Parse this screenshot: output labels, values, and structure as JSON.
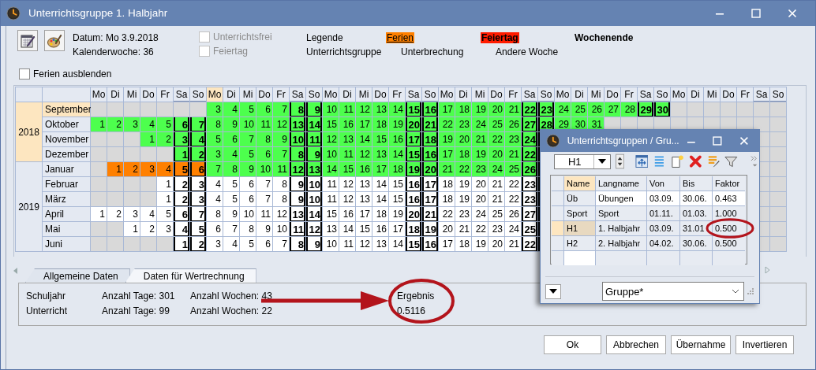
{
  "window": {
    "title": "Unterrichtsgruppe 1. Halbjahr"
  },
  "toolbar": {
    "info": [
      "Datum: Mo 3.9.2018",
      "Kalenderwoche: 36"
    ],
    "options": [
      {
        "label": "Unterrichtsfrei",
        "checked": false,
        "disabled": true
      },
      {
        "label": "Feiertag",
        "checked": false,
        "disabled": true
      }
    ],
    "legend_rows": [
      [
        {
          "label": "Legende",
          "kind": "title"
        },
        {
          "label": "Ferien",
          "kind": "holiday"
        },
        {
          "label": "Feiertag",
          "kind": "public_holiday"
        },
        {
          "label": "Wochenende",
          "kind": "weekend"
        }
      ],
      [
        {
          "label": "Unterrichtsgruppe",
          "kind": "plain"
        },
        {
          "label": "Unterbrechung",
          "kind": "plain"
        },
        {
          "label": "Andere Woche",
          "kind": "plain"
        }
      ]
    ],
    "hide_holidays": {
      "label": "Ferien ausblenden",
      "checked": false
    }
  },
  "calendar": {
    "weekdays": [
      {
        "label": "Mo",
        "weekend": false,
        "current": false
      },
      {
        "label": "Di",
        "weekend": false,
        "current": false
      },
      {
        "label": "Mi",
        "weekend": false,
        "current": false
      },
      {
        "label": "Do",
        "weekend": false,
        "current": false
      },
      {
        "label": "Fr",
        "weekend": false,
        "current": false
      },
      {
        "label": "Sa",
        "weekend": true,
        "current": false
      },
      {
        "label": "So",
        "weekend": true,
        "current": false
      },
      {
        "label": "Mo",
        "weekend": false,
        "current": true
      },
      {
        "label": "Di",
        "weekend": false,
        "current": false
      },
      {
        "label": "Mi",
        "weekend": false,
        "current": false
      },
      {
        "label": "Do",
        "weekend": false,
        "current": false
      },
      {
        "label": "Fr",
        "weekend": false,
        "current": false
      },
      {
        "label": "Sa",
        "weekend": true,
        "current": false
      },
      {
        "label": "So",
        "weekend": true,
        "current": false
      },
      {
        "label": "Mo",
        "weekend": false,
        "current": false
      },
      {
        "label": "Di",
        "weekend": false,
        "current": false
      },
      {
        "label": "Mi",
        "weekend": false,
        "current": false
      },
      {
        "label": "Do",
        "weekend": false,
        "current": false
      },
      {
        "label": "Fr",
        "weekend": false,
        "current": false
      },
      {
        "label": "Sa",
        "weekend": true,
        "current": false
      },
      {
        "label": "So",
        "weekend": true,
        "current": false
      },
      {
        "label": "Mo",
        "weekend": false,
        "current": false
      },
      {
        "label": "Di",
        "weekend": false,
        "current": false
      },
      {
        "label": "Mi",
        "weekend": false,
        "current": false
      },
      {
        "label": "Do",
        "weekend": false,
        "current": false
      },
      {
        "label": "Fr",
        "weekend": false,
        "current": false
      },
      {
        "label": "Sa",
        "weekend": true,
        "current": false
      },
      {
        "label": "So",
        "weekend": true,
        "current": false
      },
      {
        "label": "Mo",
        "weekend": false,
        "current": false
      },
      {
        "label": "Di",
        "weekend": false,
        "current": false
      },
      {
        "label": "Mi",
        "weekend": false,
        "current": false
      },
      {
        "label": "Do",
        "weekend": false,
        "current": false
      },
      {
        "label": "Fr",
        "weekend": false,
        "current": false
      },
      {
        "label": "Sa",
        "weekend": true,
        "current": false
      },
      {
        "label": "So",
        "weekend": true,
        "current": false
      },
      {
        "label": "Mo",
        "weekend": false,
        "current": false
      },
      {
        "label": "Di",
        "weekend": false,
        "current": false
      },
      {
        "label": "Mi",
        "weekend": false,
        "current": false
      },
      {
        "label": "Do",
        "weekend": false,
        "current": false
      },
      {
        "label": "Fr",
        "weekend": false,
        "current": false
      },
      {
        "label": "Sa",
        "weekend": true,
        "current": false
      },
      {
        "label": "So",
        "weekend": true,
        "current": false
      }
    ],
    "years": [
      {
        "label": "2018",
        "selected": true,
        "months": [
          {
            "name": "September",
            "selected": true,
            "cells": [
              {
                "kind": "blank"
              },
              {
                "kind": "blank"
              },
              {
                "kind": "blank"
              },
              {
                "kind": "blank"
              },
              {
                "kind": "blank"
              },
              {
                "kind": "blank"
              },
              {
                "kind": "blank"
              },
              {
                "day": "3",
                "kind": "class"
              },
              {
                "day": "4",
                "kind": "class"
              },
              {
                "day": "5",
                "kind": "class"
              },
              {
                "day": "6",
                "kind": "class"
              },
              {
                "day": "7",
                "kind": "class"
              },
              {
                "day": "8",
                "kind": "class"
              },
              {
                "day": "9",
                "kind": "class"
              },
              {
                "day": "10",
                "kind": "class"
              },
              {
                "day": "11",
                "kind": "class"
              },
              {
                "day": "12",
                "kind": "class"
              },
              {
                "day": "13",
                "kind": "class"
              },
              {
                "day": "14",
                "kind": "class"
              },
              {
                "day": "15",
                "kind": "class"
              },
              {
                "day": "16",
                "kind": "class"
              },
              {
                "day": "17",
                "kind": "class"
              },
              {
                "day": "18",
                "kind": "class"
              },
              {
                "day": "19",
                "kind": "class"
              },
              {
                "day": "20",
                "kind": "class"
              },
              {
                "day": "21",
                "kind": "class"
              },
              {
                "day": "22",
                "kind": "class"
              },
              {
                "day": "23",
                "kind": "class"
              },
              {
                "day": "24",
                "kind": "class"
              },
              {
                "day": "25",
                "kind": "class"
              },
              {
                "day": "26",
                "kind": "class"
              },
              {
                "day": "27",
                "kind": "class"
              },
              {
                "day": "28",
                "kind": "class"
              },
              {
                "day": "29",
                "kind": "class"
              },
              {
                "day": "30",
                "kind": "class"
              }
            ]
          },
          {
            "name": "Oktober",
            "selected": false,
            "cells": [
              {
                "day": "1",
                "kind": "class"
              },
              {
                "day": "2",
                "kind": "class"
              },
              {
                "day": "3",
                "kind": "class"
              },
              {
                "day": "4",
                "kind": "class"
              },
              {
                "day": "5",
                "kind": "class"
              },
              {
                "day": "6",
                "kind": "class"
              },
              {
                "day": "7",
                "kind": "class"
              },
              {
                "day": "8",
                "kind": "class"
              },
              {
                "day": "9",
                "kind": "class"
              },
              {
                "day": "10",
                "kind": "class"
              },
              {
                "day": "11",
                "kind": "class"
              },
              {
                "day": "12",
                "kind": "class"
              },
              {
                "day": "13",
                "kind": "class"
              },
              {
                "day": "14",
                "kind": "class"
              },
              {
                "day": "15",
                "kind": "class"
              },
              {
                "day": "16",
                "kind": "class"
              },
              {
                "day": "17",
                "kind": "class"
              },
              {
                "day": "18",
                "kind": "class"
              },
              {
                "day": "19",
                "kind": "class"
              },
              {
                "day": "20",
                "kind": "class"
              },
              {
                "day": "21",
                "kind": "class"
              },
              {
                "day": "22",
                "kind": "class"
              },
              {
                "day": "23",
                "kind": "class"
              },
              {
                "day": "24",
                "kind": "class"
              },
              {
                "day": "25",
                "kind": "class"
              },
              {
                "day": "26",
                "kind": "class"
              },
              {
                "day": "27",
                "kind": "class"
              },
              {
                "day": "28",
                "kind": "class"
              },
              {
                "day": "29",
                "kind": "class"
              },
              {
                "day": "30",
                "kind": "class"
              },
              {
                "day": "31",
                "kind": "class"
              }
            ]
          },
          {
            "name": "November",
            "selected": false,
            "cells": [
              {
                "kind": "blank"
              },
              {
                "kind": "blank"
              },
              {
                "kind": "blank"
              },
              {
                "day": "1",
                "kind": "class"
              },
              {
                "day": "2",
                "kind": "class"
              },
              {
                "day": "3",
                "kind": "class"
              },
              {
                "day": "4",
                "kind": "class"
              },
              {
                "day": "5",
                "kind": "class"
              },
              {
                "day": "6",
                "kind": "class"
              },
              {
                "day": "7",
                "kind": "class"
              },
              {
                "day": "8",
                "kind": "class"
              },
              {
                "day": "9",
                "kind": "class"
              },
              {
                "day": "10",
                "kind": "class"
              },
              {
                "day": "11",
                "kind": "class"
              },
              {
                "day": "12",
                "kind": "class"
              },
              {
                "day": "13",
                "kind": "class"
              },
              {
                "day": "14",
                "kind": "class"
              },
              {
                "day": "15",
                "kind": "class"
              },
              {
                "day": "16",
                "kind": "class"
              },
              {
                "day": "17",
                "kind": "class"
              },
              {
                "day": "18",
                "kind": "class"
              },
              {
                "day": "19",
                "kind": "class"
              },
              {
                "day": "20",
                "kind": "class"
              },
              {
                "day": "21",
                "kind": "class"
              },
              {
                "day": "22",
                "kind": "class"
              },
              {
                "day": "23",
                "kind": "class"
              },
              {
                "day": "24",
                "kind": "class"
              },
              {
                "kind": "class"
              }
            ]
          },
          {
            "name": "Dezember",
            "selected": false,
            "cells": [
              {
                "kind": "blank"
              },
              {
                "kind": "blank"
              },
              {
                "kind": "blank"
              },
              {
                "kind": "blank"
              },
              {
                "kind": "blank"
              },
              {
                "day": "1",
                "kind": "class"
              },
              {
                "day": "2",
                "kind": "class"
              },
              {
                "day": "3",
                "kind": "class"
              },
              {
                "day": "4",
                "kind": "class"
              },
              {
                "day": "5",
                "kind": "class"
              },
              {
                "day": "6",
                "kind": "class"
              },
              {
                "day": "7",
                "kind": "class"
              },
              {
                "day": "8",
                "kind": "class"
              },
              {
                "day": "9",
                "kind": "class"
              },
              {
                "day": "10",
                "kind": "class"
              },
              {
                "day": "11",
                "kind": "class"
              },
              {
                "day": "12",
                "kind": "class"
              },
              {
                "day": "13",
                "kind": "class"
              },
              {
                "day": "14",
                "kind": "class"
              },
              {
                "day": "15",
                "kind": "class"
              },
              {
                "day": "16",
                "kind": "class"
              },
              {
                "day": "17",
                "kind": "class"
              },
              {
                "day": "18",
                "kind": "class"
              },
              {
                "day": "19",
                "kind": "class"
              },
              {
                "day": "20",
                "kind": "class"
              },
              {
                "day": "21",
                "kind": "class"
              },
              {
                "day": "22",
                "kind": "class"
              },
              {
                "kind": "class"
              }
            ]
          }
        ]
      },
      {
        "label": "2019",
        "selected": false,
        "months": [
          {
            "name": "Januar",
            "selected": false,
            "cells": [
              {
                "kind": "blank"
              },
              {
                "day": "1",
                "kind": "holiday"
              },
              {
                "day": "2",
                "kind": "holiday"
              },
              {
                "day": "3",
                "kind": "holiday"
              },
              {
                "day": "4",
                "kind": "holiday"
              },
              {
                "day": "5",
                "kind": "holiday"
              },
              {
                "day": "6",
                "kind": "holiday"
              },
              {
                "day": "7",
                "kind": "class"
              },
              {
                "day": "8",
                "kind": "class"
              },
              {
                "day": "9",
                "kind": "class"
              },
              {
                "day": "10",
                "kind": "class"
              },
              {
                "day": "11",
                "kind": "class"
              },
              {
                "day": "12",
                "kind": "class"
              },
              {
                "day": "13",
                "kind": "class"
              },
              {
                "day": "14",
                "kind": "class"
              },
              {
                "day": "15",
                "kind": "class"
              },
              {
                "day": "16",
                "kind": "class"
              },
              {
                "day": "17",
                "kind": "class"
              },
              {
                "day": "18",
                "kind": "class"
              },
              {
                "day": "19",
                "kind": "class"
              },
              {
                "day": "20",
                "kind": "class"
              },
              {
                "day": "21",
                "kind": "class"
              },
              {
                "day": "22",
                "kind": "class"
              },
              {
                "day": "23",
                "kind": "class"
              },
              {
                "day": "24",
                "kind": "class"
              },
              {
                "day": "25",
                "kind": "class"
              },
              {
                "day": "26",
                "kind": "class"
              },
              {
                "kind": "class"
              }
            ]
          },
          {
            "name": "Februar",
            "selected": false,
            "cells": [
              {
                "kind": "blank"
              },
              {
                "kind": "blank"
              },
              {
                "kind": "blank"
              },
              {
                "kind": "blank"
              },
              {
                "day": "1",
                "kind": "other"
              },
              {
                "day": "2",
                "kind": "other"
              },
              {
                "day": "3",
                "kind": "other"
              },
              {
                "day": "4",
                "kind": "other"
              },
              {
                "day": "5",
                "kind": "other"
              },
              {
                "day": "6",
                "kind": "other"
              },
              {
                "day": "7",
                "kind": "other"
              },
              {
                "day": "8",
                "kind": "other"
              },
              {
                "day": "9",
                "kind": "other"
              },
              {
                "day": "10",
                "kind": "other"
              },
              {
                "day": "11",
                "kind": "other"
              },
              {
                "day": "12",
                "kind": "other"
              },
              {
                "day": "13",
                "kind": "other"
              },
              {
                "day": "14",
                "kind": "other"
              },
              {
                "day": "15",
                "kind": "other"
              },
              {
                "day": "16",
                "kind": "other"
              },
              {
                "day": "17",
                "kind": "other"
              },
              {
                "day": "18",
                "kind": "other"
              },
              {
                "day": "19",
                "kind": "other"
              },
              {
                "day": "20",
                "kind": "other"
              },
              {
                "day": "21",
                "kind": "other"
              },
              {
                "day": "22",
                "kind": "other"
              },
              {
                "day": "23",
                "kind": "other"
              },
              {
                "kind": "other"
              }
            ]
          },
          {
            "name": "März",
            "selected": false,
            "cells": [
              {
                "kind": "blank"
              },
              {
                "kind": "blank"
              },
              {
                "kind": "blank"
              },
              {
                "kind": "blank"
              },
              {
                "day": "1",
                "kind": "other"
              },
              {
                "day": "2",
                "kind": "other"
              },
              {
                "day": "3",
                "kind": "other"
              },
              {
                "day": "4",
                "kind": "other"
              },
              {
                "day": "5",
                "kind": "other"
              },
              {
                "day": "6",
                "kind": "other"
              },
              {
                "day": "7",
                "kind": "other"
              },
              {
                "day": "8",
                "kind": "other"
              },
              {
                "day": "9",
                "kind": "other"
              },
              {
                "day": "10",
                "kind": "other"
              },
              {
                "day": "11",
                "kind": "other"
              },
              {
                "day": "12",
                "kind": "other"
              },
              {
                "day": "13",
                "kind": "other"
              },
              {
                "day": "14",
                "kind": "other"
              },
              {
                "day": "15",
                "kind": "other"
              },
              {
                "day": "16",
                "kind": "other"
              },
              {
                "day": "17",
                "kind": "other"
              },
              {
                "day": "18",
                "kind": "other"
              },
              {
                "day": "19",
                "kind": "other"
              },
              {
                "day": "20",
                "kind": "other"
              },
              {
                "day": "21",
                "kind": "other"
              },
              {
                "day": "22",
                "kind": "other"
              },
              {
                "day": "23",
                "kind": "other"
              },
              {
                "kind": "other"
              }
            ]
          },
          {
            "name": "April",
            "selected": false,
            "cells": [
              {
                "day": "1",
                "kind": "other"
              },
              {
                "day": "2",
                "kind": "other"
              },
              {
                "day": "3",
                "kind": "other"
              },
              {
                "day": "4",
                "kind": "other"
              },
              {
                "day": "5",
                "kind": "other"
              },
              {
                "day": "6",
                "kind": "other"
              },
              {
                "day": "7",
                "kind": "other"
              },
              {
                "day": "8",
                "kind": "other"
              },
              {
                "day": "9",
                "kind": "other"
              },
              {
                "day": "10",
                "kind": "other"
              },
              {
                "day": "11",
                "kind": "other"
              },
              {
                "day": "12",
                "kind": "other"
              },
              {
                "day": "13",
                "kind": "other"
              },
              {
                "day": "14",
                "kind": "other"
              },
              {
                "day": "15",
                "kind": "other"
              },
              {
                "day": "16",
                "kind": "other"
              },
              {
                "day": "17",
                "kind": "other"
              },
              {
                "day": "18",
                "kind": "other"
              },
              {
                "day": "19",
                "kind": "other"
              },
              {
                "day": "20",
                "kind": "other"
              },
              {
                "day": "21",
                "kind": "other"
              },
              {
                "day": "22",
                "kind": "other"
              },
              {
                "day": "23",
                "kind": "other"
              },
              {
                "day": "24",
                "kind": "other"
              },
              {
                "day": "25",
                "kind": "other"
              },
              {
                "day": "26",
                "kind": "other"
              },
              {
                "day": "27",
                "kind": "other"
              },
              {
                "kind": "other"
              }
            ]
          },
          {
            "name": "Mai",
            "selected": false,
            "cells": [
              {
                "kind": "blank"
              },
              {
                "kind": "blank"
              },
              {
                "day": "1",
                "kind": "other"
              },
              {
                "day": "2",
                "kind": "other"
              },
              {
                "day": "3",
                "kind": "other"
              },
              {
                "day": "4",
                "kind": "other"
              },
              {
                "day": "5",
                "kind": "other"
              },
              {
                "day": "6",
                "kind": "other"
              },
              {
                "day": "7",
                "kind": "other"
              },
              {
                "day": "8",
                "kind": "other"
              },
              {
                "day": "9",
                "kind": "other"
              },
              {
                "day": "10",
                "kind": "other"
              },
              {
                "day": "11",
                "kind": "other"
              },
              {
                "day": "12",
                "kind": "other"
              },
              {
                "day": "13",
                "kind": "other"
              },
              {
                "day": "14",
                "kind": "other"
              },
              {
                "day": "15",
                "kind": "other"
              },
              {
                "day": "16",
                "kind": "other"
              },
              {
                "day": "17",
                "kind": "other"
              },
              {
                "day": "18",
                "kind": "other"
              },
              {
                "day": "19",
                "kind": "other"
              },
              {
                "day": "20",
                "kind": "other"
              },
              {
                "day": "21",
                "kind": "other"
              },
              {
                "day": "22",
                "kind": "other"
              },
              {
                "day": "23",
                "kind": "other"
              },
              {
                "day": "24",
                "kind": "other"
              },
              {
                "day": "25",
                "kind": "other"
              },
              {
                "kind": "other"
              }
            ]
          },
          {
            "name": "Juni",
            "selected": false,
            "cells": [
              {
                "kind": "blank"
              },
              {
                "kind": "blank"
              },
              {
                "kind": "blank"
              },
              {
                "kind": "blank"
              },
              {
                "kind": "blank"
              },
              {
                "day": "1",
                "kind": "other"
              },
              {
                "day": "2",
                "kind": "other"
              },
              {
                "day": "3",
                "kind": "other"
              },
              {
                "day": "4",
                "kind": "other"
              },
              {
                "day": "5",
                "kind": "other"
              },
              {
                "day": "6",
                "kind": "other"
              },
              {
                "day": "7",
                "kind": "other"
              },
              {
                "day": "8",
                "kind": "other"
              },
              {
                "day": "9",
                "kind": "other"
              },
              {
                "day": "10",
                "kind": "other"
              },
              {
                "day": "11",
                "kind": "other"
              },
              {
                "day": "12",
                "kind": "other"
              },
              {
                "day": "13",
                "kind": "other"
              },
              {
                "day": "14",
                "kind": "other"
              },
              {
                "day": "15",
                "kind": "other"
              },
              {
                "day": "16",
                "kind": "other"
              },
              {
                "day": "17",
                "kind": "other"
              },
              {
                "day": "18",
                "kind": "other"
              },
              {
                "day": "19",
                "kind": "other"
              },
              {
                "day": "20",
                "kind": "other"
              },
              {
                "day": "21",
                "kind": "other"
              },
              {
                "day": "22",
                "kind": "other"
              },
              {
                "kind": "other"
              }
            ]
          }
        ]
      }
    ]
  },
  "tabs": [
    {
      "label": "Allgemeine Daten",
      "selected": false
    },
    {
      "label": "Daten für Wertrechnung",
      "selected": true
    }
  ],
  "summary": {
    "rows": [
      {
        "label": "Schuljahr",
        "days": "Anzahl Tage: 301",
        "weeks": "Anzahl Wochen: 43"
      },
      {
        "label": "Unterricht",
        "days": "Anzahl Tage: 99",
        "weeks": "Anzahl Wochen: 22"
      }
    ],
    "result_label": "Ergebnis",
    "result_value": "0.5116"
  },
  "buttons": [
    "Ok",
    "Abbrechen",
    "Übernahme",
    "Invertieren"
  ],
  "popup": {
    "title": "Unterrichtsgruppen / Gru...",
    "selector": "H1",
    "columns": [
      {
        "label": "Name",
        "selected": true
      },
      {
        "label": "Langname",
        "selected": false
      },
      {
        "label": "Von",
        "selected": false
      },
      {
        "label": "Bis",
        "selected": false
      },
      {
        "label": "Faktor",
        "selected": false
      }
    ],
    "rows": [
      {
        "cells": [
          "Üb",
          "Übungen",
          "03.09.",
          "30.06.",
          "0.463"
        ],
        "selected": false
      },
      {
        "cells": [
          "Sport",
          "Sport",
          "01.11.",
          "01.03.",
          "1.000"
        ],
        "selected": false
      },
      {
        "cells": [
          "H1",
          "1. Halbjahr",
          "03.09.",
          "31.01",
          "0.500"
        ],
        "selected": true
      },
      {
        "cells": [
          "H2",
          "2. Halbjahr",
          "04.02.",
          "30.06.",
          "0.500"
        ],
        "selected": false
      }
    ],
    "filter": "Gruppe*"
  }
}
